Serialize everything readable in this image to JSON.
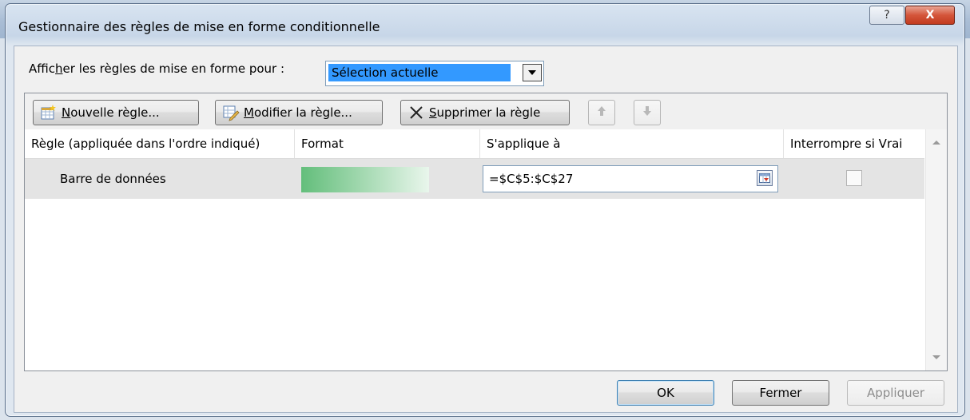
{
  "window": {
    "title": "Gestionnaire des règles de mise en forme conditionnelle",
    "help_glyph": "?",
    "close_glyph": "X"
  },
  "filter": {
    "label_pre": "Affic",
    "label_accel": "h",
    "label_post": "er les règles de mise en forme pour :",
    "selected": "Sélection actuelle"
  },
  "toolbar": {
    "new_rule": {
      "accel": "N",
      "rest": "ouvelle règle..."
    },
    "edit_rule": {
      "accel": "M",
      "rest": "odifier la règle..."
    },
    "delete_rule": {
      "accel": "S",
      "rest": "upprimer la règle"
    }
  },
  "grid": {
    "columns": [
      "Règle (appliquée dans l'ordre indiqué)",
      "Format",
      "S'applique à",
      "Interrompre si Vrai"
    ],
    "rows": [
      {
        "rule": "Barre de données",
        "applies_to": "=$C$5:$C$27",
        "stop_if_true": false,
        "format_color": "#63BE7B"
      }
    ]
  },
  "buttons": {
    "ok": "OK",
    "close": "Fermer",
    "apply": "Appliquer"
  },
  "colors": {
    "selection": "#3399FF",
    "databar": "#63BE7B",
    "close_button": "#C23B1F"
  }
}
